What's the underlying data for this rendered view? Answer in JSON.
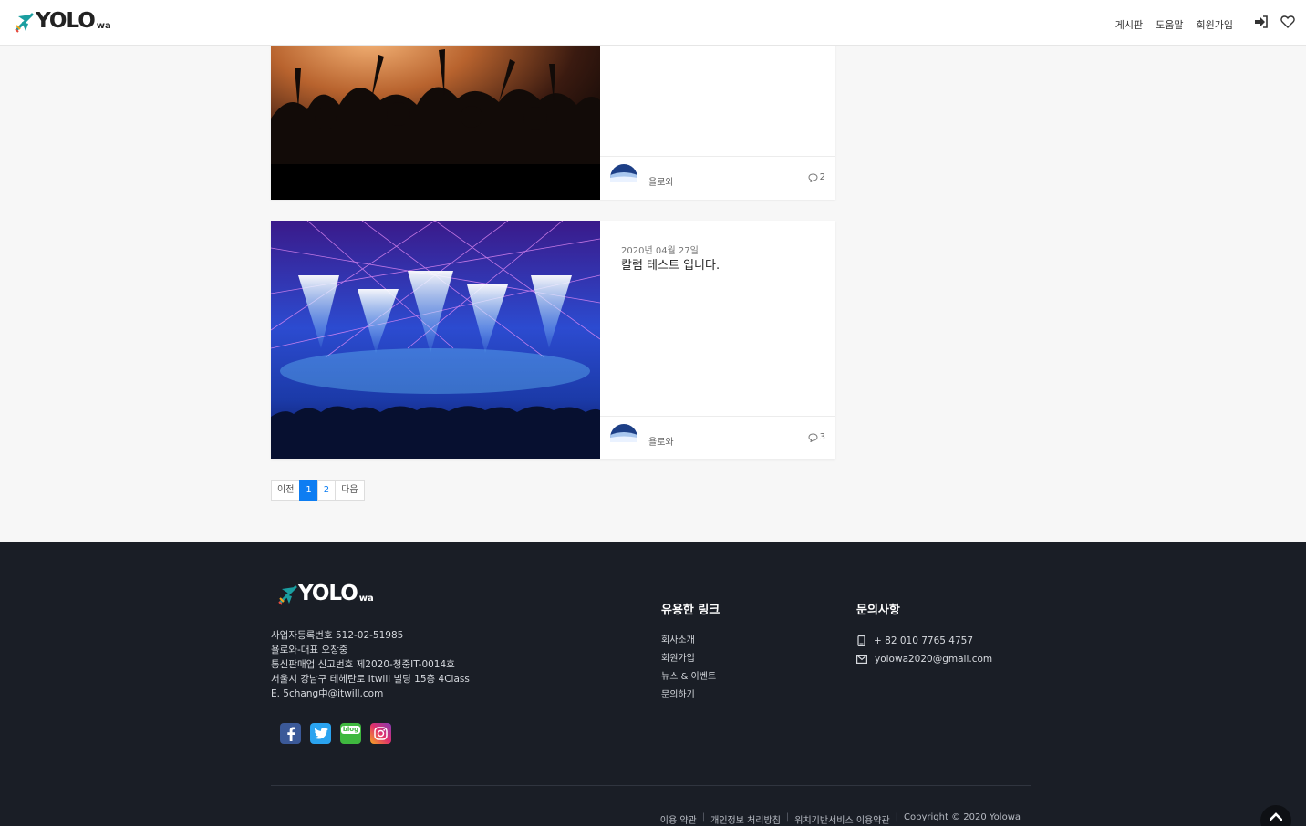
{
  "header": {
    "logo_text": "YOLO",
    "logo_sub": "wa",
    "nav": [
      "게시판",
      "도움말",
      "회원가입"
    ],
    "icons": [
      "login-icon",
      "heart-icon"
    ]
  },
  "posts": [
    {
      "date": "",
      "title": "",
      "author": "욜로와",
      "comments": "2",
      "image": "concert-crowd-image"
    },
    {
      "date": "2020년 04월 27일",
      "title": "칼럼 테스트 입니다.",
      "author": "욜로와",
      "comments": "3",
      "image": "concert-stage-lights-image"
    }
  ],
  "pagination": {
    "prev": "이전",
    "pages": [
      "1",
      "2"
    ],
    "current": "1",
    "next": "다음"
  },
  "footer": {
    "logo_text": "YOLO",
    "logo_sub": "wa",
    "info": [
      "사업자등록번호 512-02-51985",
      "욜로와-대표 오창중",
      "통신판매업 신고번호 제2020-청중IT-0014호",
      "서울시 강남구 테헤란로 Itwill 빌딩 15층 4Class",
      "E. 5chang中@itwill.com"
    ],
    "social": [
      "facebook-icon",
      "twitter-icon",
      "blog-icon",
      "instagram-icon"
    ],
    "links_heading": "유용한 링크",
    "links": [
      "회사소개",
      "회원가입",
      "뉴스 & 이벤트",
      "문의하기"
    ],
    "contact_heading": "문의사항",
    "phone": "+ 82 010 7765 4757",
    "email": "yolowa2020@gmail.com",
    "bottom_links": [
      "이용 약관",
      "개인정보 처리방침",
      "위치기반서비스 이용약관"
    ],
    "copyright": "Copyright © 2020 Yolowa",
    "blog_badge": "blog"
  },
  "colors": {
    "accent": "#0d7df2",
    "footer_bg": "#1a1e26",
    "page_bg": "#f7f7f7"
  }
}
